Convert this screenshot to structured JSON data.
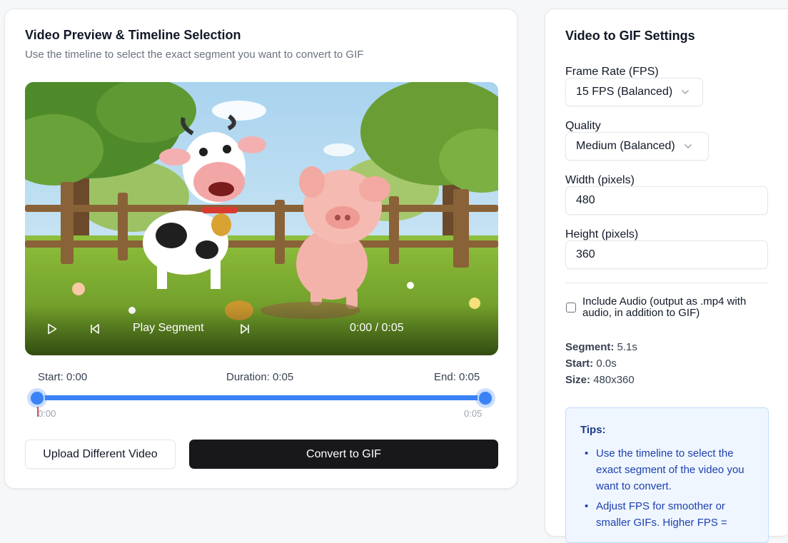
{
  "preview": {
    "title": "Video Preview & Timeline Selection",
    "subtitle": "Use the timeline to select the exact segment you want to convert to GIF",
    "controls": {
      "play_segment_label": "Play Segment",
      "time_display": "0:00 / 0:05"
    },
    "timeline": {
      "start_label": "Start: 0:00",
      "duration_label": "Duration: 0:05",
      "end_label": "End: 0:05",
      "min_tick": "0:00",
      "max_tick": "0:05",
      "selection_start_fraction": 0.0,
      "selection_end_fraction": 1.0,
      "playhead_fraction": 0.0
    },
    "buttons": {
      "upload_label": "Upload Different Video",
      "convert_label": "Convert to GIF"
    }
  },
  "settings": {
    "title": "Video to GIF Settings",
    "frame_rate": {
      "label": "Frame Rate (FPS)",
      "value": "15 FPS (Balanced)"
    },
    "quality": {
      "label": "Quality",
      "value": "Medium (Balanced)"
    },
    "width": {
      "label": "Width (pixels)",
      "value": "480"
    },
    "height": {
      "label": "Height (pixels)",
      "value": "360"
    },
    "include_audio": {
      "label": "Include Audio (output as .mp4 with audio, in addition to GIF)",
      "checked": false
    },
    "stats": {
      "segment_key": "Segment:",
      "segment_value": "5.1s",
      "start_key": "Start:",
      "start_value": "0.0s",
      "size_key": "Size:",
      "size_value": "480x360"
    },
    "tips": {
      "title": "Tips:",
      "items": [
        "Use the timeline to select the exact segment of the video you want to convert.",
        "Adjust FPS for smoother or smaller GIFs. Higher FPS ="
      ]
    }
  },
  "colors": {
    "accent": "#3b82f6",
    "dark_button": "#18181b",
    "tips_bg": "#eff6ff",
    "tips_text": "#1e40af"
  }
}
